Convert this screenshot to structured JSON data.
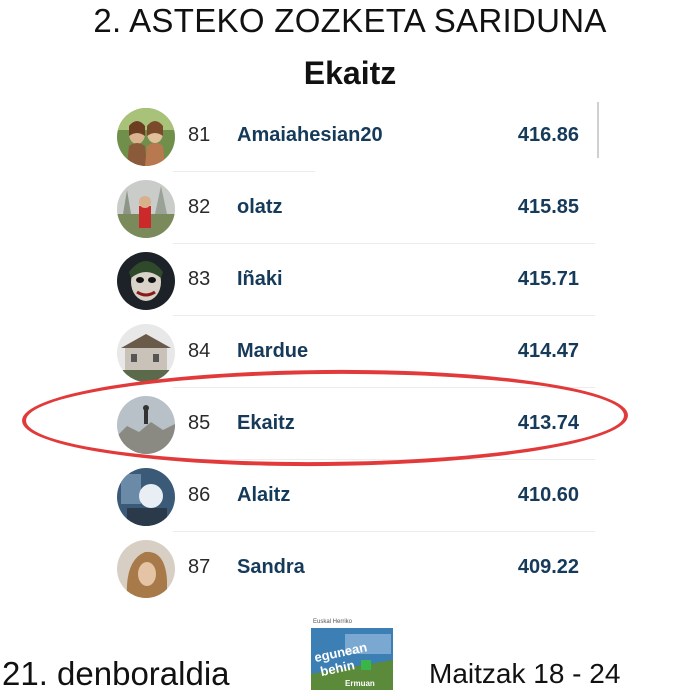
{
  "header": {
    "title": "2. ASTEKO ZOZKETA SARIDUNA",
    "winner": "Ekaitz"
  },
  "leaderboard": {
    "rows": [
      {
        "rank": "81",
        "name": "Amaiahesian20",
        "score": "416.86"
      },
      {
        "rank": "82",
        "name": "olatz",
        "score": "415.85"
      },
      {
        "rank": "83",
        "name": "Iñaki",
        "score": "415.71"
      },
      {
        "rank": "84",
        "name": "Mardue",
        "score": "414.47"
      },
      {
        "rank": "85",
        "name": "Ekaitz",
        "score": "413.74"
      },
      {
        "rank": "86",
        "name": "Alaitz",
        "score": "410.60"
      },
      {
        "rank": "87",
        "name": "Sandra",
        "score": "409.22"
      }
    ],
    "highlighted_rank": "85"
  },
  "footer": {
    "season": "21. denboraldia",
    "dates": "Maitzak 18 - 24",
    "logo": {
      "top_text": "Euskal Herriko",
      "main_text_1": "egunean",
      "main_text_2": "behin",
      "sub_text": "Ermuan"
    }
  },
  "colors": {
    "highlight_ring": "#e23a3a",
    "name_text": "#163a5a"
  }
}
